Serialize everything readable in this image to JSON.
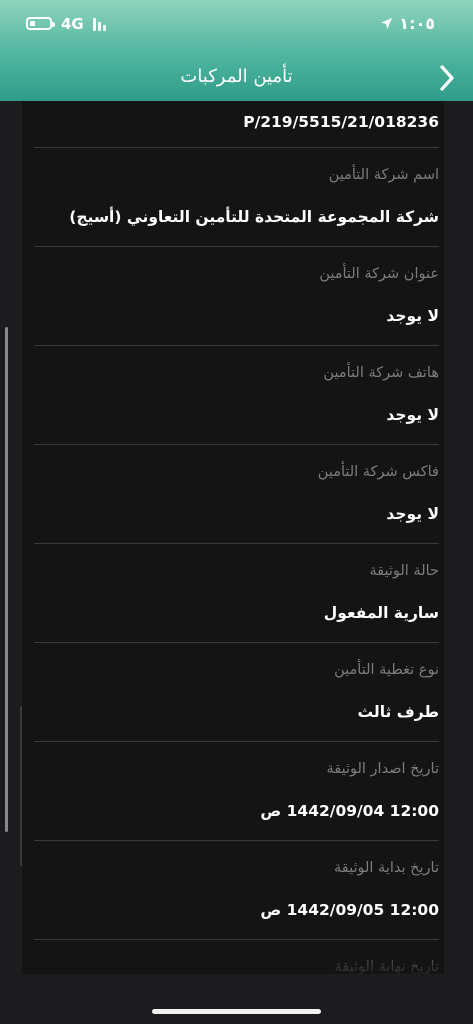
{
  "status_bar": {
    "network": "4G",
    "time": "١:٠٥",
    "battery_level": 0.3
  },
  "header": {
    "title": "تأمين المركبات",
    "back_icon": "chevron-right-icon"
  },
  "policy_number": "P/219/5515/21/018236",
  "fields": [
    {
      "label": "اسم شركة التأمين",
      "value": "شركة المجموعة المتحدة للتأمين التعاوني (أسيج)"
    },
    {
      "label": "عنوان شركة التأمين",
      "value": "لا يوجد"
    },
    {
      "label": "هاتف شركة التأمين",
      "value": "لا يوجد"
    },
    {
      "label": "فاكس شركة التأمين",
      "value": "لا يوجد"
    },
    {
      "label": "حالة الوثيقة",
      "value": "سارية المفعول"
    },
    {
      "label": "نوع تغطية التأمين",
      "value": "طرف ثالث"
    },
    {
      "label": "تاريخ اصدار الوثيقة",
      "value": "12:00 1442/09/04 ص"
    },
    {
      "label": "تاريخ بداية الوثيقة",
      "value": "12:00 1442/09/05 ص"
    },
    {
      "label": "تاريخ نهاية الوثيقة",
      "value": ""
    }
  ],
  "colors": {
    "header_top": "#8fd3bd",
    "header_bottom": "#2f9c8a",
    "background": "#1c1c1e",
    "label": "#7c7c80",
    "value": "#ffffff"
  }
}
